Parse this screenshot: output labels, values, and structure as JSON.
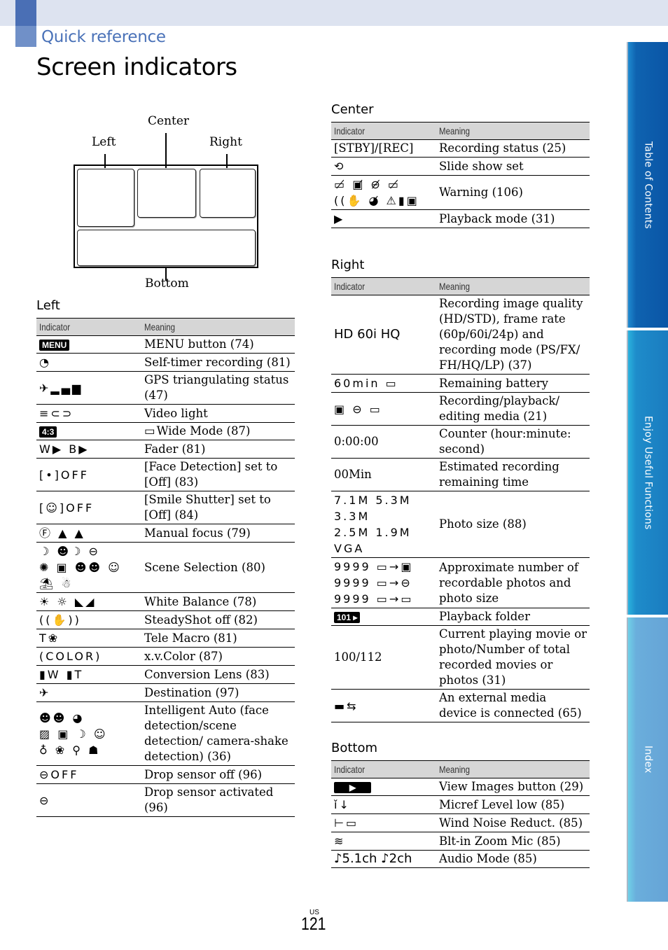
{
  "header": {
    "section": "Quick reference",
    "title": "Screen indicators"
  },
  "side_tabs": [
    {
      "label": "Table of Contents"
    },
    {
      "label": "Enjoy Useful Functions"
    },
    {
      "label": "Index"
    }
  ],
  "diagram": {
    "center": "Center",
    "left": "Left",
    "right": "Right",
    "bottom": "Bottom"
  },
  "columns": {
    "indicator": "Indicator",
    "meaning": "Meaning"
  },
  "left": {
    "heading": "Left",
    "rows": [
      {
        "icon": "menu-button-icon",
        "indicator": "MENU",
        "meaning": "MENU button (74)"
      },
      {
        "icon": "self-timer-icon",
        "indicator": "◔",
        "meaning": "Self-timer recording (81)"
      },
      {
        "icon": "gps-status-icon",
        "indicator": "✈▂▄▆",
        "meaning": "GPS triangulating status (47)"
      },
      {
        "icon": "video-light-icon",
        "indicator": "≡⊂⊃",
        "meaning": "Video light"
      },
      {
        "icon": "wide-mode-icon",
        "indicator": "4:3",
        "meaning": "Wide Mode (87)",
        "meaning_icon": "▭"
      },
      {
        "icon": "fader-icon",
        "indicator": "W▶ B▶",
        "meaning": "Fader (81)"
      },
      {
        "icon": "face-detection-off-icon",
        "indicator": "[•]OFF",
        "meaning": "[Face Detection] set to [Off] (83)"
      },
      {
        "icon": "smile-shutter-off-icon",
        "indicator": "[☺]OFF",
        "meaning": "[Smile Shutter] set to [Off] (84)"
      },
      {
        "icon": "manual-focus-icon",
        "indicator": "Ⓕ ▲ ▲",
        "meaning": "Manual focus (79)"
      },
      {
        "icon": "scene-selection-icon",
        "indicator": "☽ ☻☽ ⊖\n✺ ▣ ☻☻ ☺\n⛱ ☃",
        "meaning": "Scene Selection (80)"
      },
      {
        "icon": "white-balance-icon",
        "indicator": "☀ ☼ ◣◢",
        "meaning": "White Balance (78)"
      },
      {
        "icon": "steadyshot-off-icon",
        "indicator": "((✋))",
        "meaning": "SteadyShot off (82)"
      },
      {
        "icon": "tele-macro-icon",
        "indicator": "T❀",
        "meaning": "Tele Macro (81)"
      },
      {
        "icon": "xvcolor-icon",
        "indicator": "(COLOR)",
        "meaning": "x.v.Color (87)"
      },
      {
        "icon": "conversion-lens-icon",
        "indicator": "▮W ▮T",
        "meaning": "Conversion Lens (83)"
      },
      {
        "icon": "destination-icon",
        "indicator": "✈",
        "meaning": "Destination (97)"
      },
      {
        "icon": "intelligent-auto-icon",
        "indicator": "☻☻ ◕\n▨ ▣ ☽ ☺\n♁ ❀ ⚲ ☗",
        "meaning": "Intelligent Auto (face detection/scene detection/ camera-shake detection) (36)"
      },
      {
        "icon": "drop-sensor-off-icon",
        "indicator": "⊖OFF",
        "meaning": "Drop sensor off (96)"
      },
      {
        "icon": "drop-sensor-activated-icon",
        "indicator": "⊖",
        "meaning": "Drop sensor activated (96)"
      }
    ]
  },
  "center": {
    "heading": "Center",
    "rows": [
      {
        "icon": "",
        "indicator": "[STBY]/[REC]",
        "meaning": "Recording status (25)"
      },
      {
        "icon": "slide-show-icon",
        "indicator": "⟲",
        "meaning": "Slide show set"
      },
      {
        "icon": "warning-icon",
        "indicator": "▭̸ ▣̸ ⊖̸ ▭̸\n((✋ ◕̸ ⚠▮▣",
        "meaning": "Warning (106)"
      },
      {
        "icon": "playback-mode-icon",
        "indicator": "▶",
        "meaning": "Playback mode (31)"
      }
    ]
  },
  "right": {
    "heading": "Right",
    "rows": [
      {
        "icon": "image-quality-icon",
        "indicator": "HD 60i HQ",
        "meaning": "Recording image quality (HD/STD), frame rate (60p/60i/24p) and recording mode (PS/FX/ FH/HQ/LP) (37)"
      },
      {
        "icon": "battery-icon",
        "indicator": "60min ▭",
        "meaning": "Remaining battery"
      },
      {
        "icon": "media-icon",
        "indicator": "▣ ⊖ ▭",
        "meaning": "Recording/playback/ editing media (21)"
      },
      {
        "icon": "",
        "indicator": "0:00:00",
        "meaning": "Counter (hour:minute: second)"
      },
      {
        "icon": "",
        "indicator": "00Min",
        "meaning": "Estimated recording remaining time"
      },
      {
        "icon": "photo-size-icon",
        "indicator": "7.1M 5.3M 3.3M\n2.5M 1.9M VGA",
        "meaning": "Photo size (88)"
      },
      {
        "icon": "recordable-photos-icon",
        "indicator": "9999 ▭→▣\n9999 ▭→⊖\n9999 ▭→▭",
        "meaning": "Approximate number of recordable photos and photo size"
      },
      {
        "icon": "playback-folder-icon",
        "indicator": "101 ▸",
        "meaning": "Playback folder"
      },
      {
        "icon": "",
        "indicator": "100/112",
        "meaning": "Current playing movie or photo/Number of total recorded movies or photos (31)"
      },
      {
        "icon": "external-media-icon",
        "indicator": "▬⇆",
        "meaning": "An external media device is connected (65)"
      }
    ]
  },
  "bottom": {
    "heading": "Bottom",
    "rows": [
      {
        "icon": "view-images-button-icon",
        "indicator": "▶",
        "meaning": "View Images button (29)"
      },
      {
        "icon": "micref-level-icon",
        "indicator": "ǐ↓",
        "meaning": "Micref Level low (85)"
      },
      {
        "icon": "wind-noise-icon",
        "indicator": "⊢▭",
        "meaning": "Wind Noise Reduct. (85)"
      },
      {
        "icon": "zoom-mic-icon",
        "indicator": "≋",
        "meaning": "Blt-in Zoom Mic (85)"
      },
      {
        "icon": "audio-mode-icon",
        "indicator": "♪5.1ch ♪2ch",
        "meaning": "Audio Mode (85)"
      }
    ]
  },
  "footer": {
    "region": "US",
    "page": "121"
  }
}
